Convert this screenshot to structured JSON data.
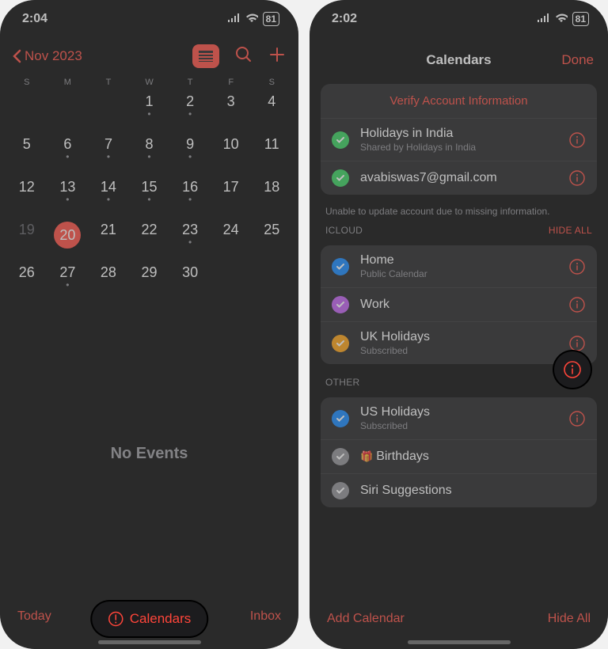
{
  "left": {
    "status": {
      "time": "2:04",
      "battery": "81"
    },
    "nav": {
      "back_label": "Nov 2023"
    },
    "weekdays": [
      "S",
      "M",
      "T",
      "W",
      "T",
      "F",
      "S"
    ],
    "calendar_rows": [
      [
        {
          "n": "",
          "dim": true
        },
        {
          "n": "",
          "dim": true
        },
        {
          "n": "",
          "dim": true
        },
        {
          "n": "1",
          "dot": true
        },
        {
          "n": "2",
          "dot": true
        },
        {
          "n": "3"
        },
        {
          "n": "4"
        }
      ],
      [
        {
          "n": "5"
        },
        {
          "n": "6",
          "dot": true
        },
        {
          "n": "7",
          "dot": true
        },
        {
          "n": "8",
          "dot": true
        },
        {
          "n": "9",
          "dot": true
        },
        {
          "n": "10"
        },
        {
          "n": "11"
        }
      ],
      [
        {
          "n": "12"
        },
        {
          "n": "13",
          "dot": true
        },
        {
          "n": "14",
          "dot": true
        },
        {
          "n": "15",
          "dot": true
        },
        {
          "n": "16",
          "dot": true
        },
        {
          "n": "17"
        },
        {
          "n": "18"
        }
      ],
      [
        {
          "n": "19",
          "dim": true
        },
        {
          "n": "20",
          "selected": true
        },
        {
          "n": "21"
        },
        {
          "n": "22"
        },
        {
          "n": "23",
          "dot": true
        },
        {
          "n": "24"
        },
        {
          "n": "25"
        }
      ],
      [
        {
          "n": "26"
        },
        {
          "n": "27",
          "dot": true
        },
        {
          "n": "28"
        },
        {
          "n": "29"
        },
        {
          "n": "30"
        },
        {
          "n": ""
        },
        {
          "n": ""
        }
      ]
    ],
    "no_events": "No Events",
    "bottom": {
      "today": "Today",
      "calendars": "Calendars",
      "inbox": "Inbox"
    }
  },
  "right": {
    "status": {
      "time": "2:02",
      "battery": "81"
    },
    "header": {
      "title": "Calendars",
      "done": "Done"
    },
    "verify_label": "Verify Account Information",
    "account_items": [
      {
        "title": "Holidays in India",
        "sub": "Shared by Holidays in India",
        "color": "#30d158"
      },
      {
        "title": "avabiswas7@gmail.com",
        "sub": "",
        "color": "#30d158"
      }
    ],
    "account_footer": "Unable to update account due to missing information.",
    "icloud_header": "ICLOUD",
    "icloud_hide": "HIDE ALL",
    "icloud_items": [
      {
        "title": "Home",
        "sub": "Public Calendar",
        "color": "#0a84ff"
      },
      {
        "title": "Work",
        "sub": "",
        "color": "#bf5af2"
      },
      {
        "title": "UK Holidays",
        "sub": "Subscribed",
        "color": "#ff9f0a"
      }
    ],
    "other_header": "OTHER",
    "other_items": [
      {
        "title": "US Holidays",
        "sub": "Subscribed",
        "color": "#0a84ff",
        "info": true
      },
      {
        "title": "Birthdays",
        "sub": "",
        "color": "#8e8e93",
        "gift": true
      },
      {
        "title": "Siri Suggestions",
        "sub": "",
        "color": "#8e8e93"
      }
    ],
    "bottom": {
      "add": "Add Calendar",
      "hide": "Hide All"
    }
  }
}
